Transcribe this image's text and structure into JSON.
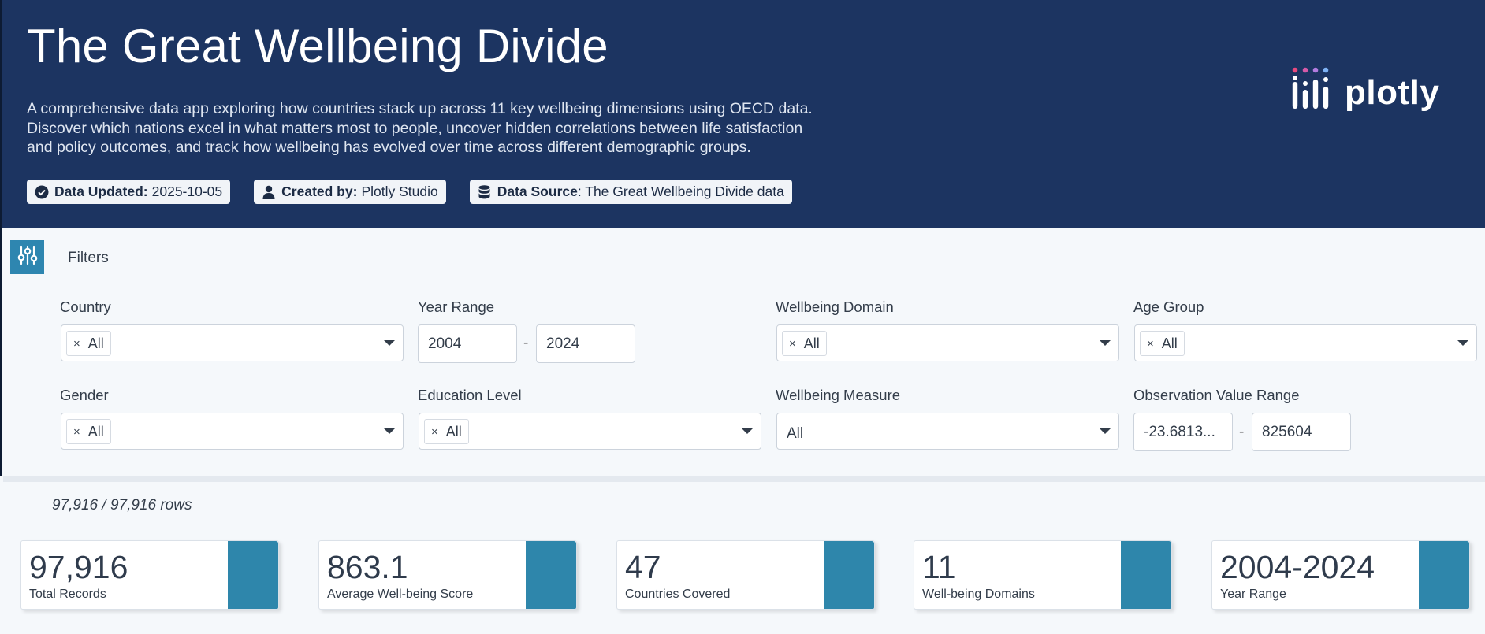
{
  "header": {
    "title": "The Great Wellbeing Divide",
    "description_lines": [
      "A comprehensive data app exploring how countries stack up across 11 key wellbeing dimensions using OECD data.",
      "Discover which nations excel in what matters most to people, uncover hidden correlations between life satisfaction",
      "and policy outcomes, and track how wellbeing has evolved over time across different demographic groups."
    ],
    "badges": {
      "updated": {
        "label": "Data Updated:",
        "value": "2025-10-05",
        "icon": "check-circle-icon"
      },
      "created": {
        "label": "Created by:",
        "value": "Plotly Studio",
        "icon": "user-icon"
      },
      "source": {
        "label": "Data Source",
        "value": ": The Great Wellbeing Divide data",
        "icon": "database-icon"
      }
    },
    "logo_text": "plotly"
  },
  "filters": {
    "label": "Filters",
    "country": {
      "label": "Country",
      "chip": "All"
    },
    "year_range": {
      "label": "Year Range",
      "from": "2004",
      "to": "2024",
      "sep": "-"
    },
    "domain": {
      "label": "Wellbeing Domain",
      "chip": "All"
    },
    "age_group": {
      "label": "Age Group",
      "chip": "All"
    },
    "gender": {
      "label": "Gender",
      "chip": "All"
    },
    "education": {
      "label": "Education Level",
      "chip": "All"
    },
    "measure": {
      "label": "Wellbeing Measure",
      "value": "All"
    },
    "obs_range": {
      "label": "Observation Value Range",
      "from": "-23.6813...",
      "to": "825604",
      "sep": "-"
    }
  },
  "stats": {
    "rows": "97,916 / 97,916 rows",
    "cards": [
      {
        "value": "97,916",
        "label": "Total Records"
      },
      {
        "value": "863.1",
        "label": "Average Well-being Score"
      },
      {
        "value": "47",
        "label": "Countries Covered"
      },
      {
        "value": "11",
        "label": "Well-being Domains"
      },
      {
        "value": "2004-2024",
        "label": "Year Range"
      }
    ]
  },
  "colors": {
    "header_bg": "#1c3461",
    "accent": "#2e86ab",
    "logo_dots": [
      "#e84a7f",
      "#c86dd7",
      "#7fb3f5"
    ]
  }
}
